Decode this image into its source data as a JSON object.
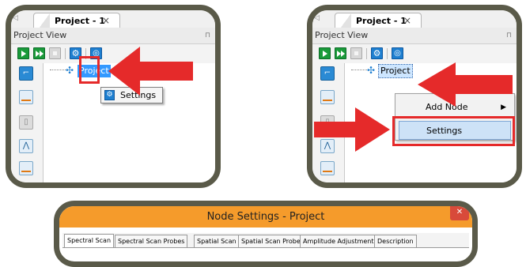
{
  "left_panel": {
    "tab_label": "Project - 1",
    "tab_close": "×",
    "panel_title": "Project View",
    "pin_glyph": "⊓",
    "toolbar": {
      "run_label": "",
      "settings_icon": "gear-icon"
    },
    "tree": {
      "node_label": "Project"
    },
    "popup": {
      "label": "Settings"
    }
  },
  "right_panel": {
    "tab_label": "Project - 1",
    "tab_close": "×",
    "panel_title": "Project View",
    "pin_glyph": "⊓",
    "tree": {
      "node_label": "Project"
    },
    "context_menu": {
      "items": [
        {
          "label": "Add Node",
          "submenu_arrow": "▶"
        },
        {
          "label": "Settings"
        }
      ]
    }
  },
  "dialog": {
    "title": "Node Settings - Project",
    "close_glyph": "✕",
    "tabs": [
      "Spectral Scan",
      "Spectral Scan Probes",
      "Spatial Scan",
      "Spatial Scan Probes",
      "Amplitude Adjustment",
      "Description"
    ],
    "active_tab": "Spectral Scan"
  },
  "colors": {
    "frame": "#5a5a49",
    "highlight_red": "#e52a2a",
    "title_orange": "#f59b2b",
    "selection_blue": "#3399ff"
  }
}
